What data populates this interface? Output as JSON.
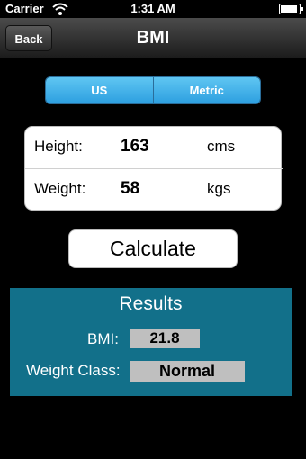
{
  "status_bar": {
    "carrier": "Carrier",
    "time": "1:31 AM",
    "wifi_icon": "wifi-icon",
    "battery_icon": "battery-icon"
  },
  "nav": {
    "title": "BMI",
    "back_label": "Back"
  },
  "unit_selector": {
    "options": [
      "US",
      "Metric"
    ],
    "accent_color": "#2d9fe0"
  },
  "inputs": {
    "height": {
      "label": "Height:",
      "value": "163",
      "unit": "cms"
    },
    "weight": {
      "label": "Weight:",
      "value": "58",
      "unit": "kgs"
    }
  },
  "calculate_label": "Calculate",
  "results": {
    "title": "Results",
    "bmi_label": "BMI:",
    "bmi_value": "21.8",
    "weight_class_label": "Weight Class:",
    "weight_class_value": "Normal",
    "panel_color": "#12708a"
  }
}
